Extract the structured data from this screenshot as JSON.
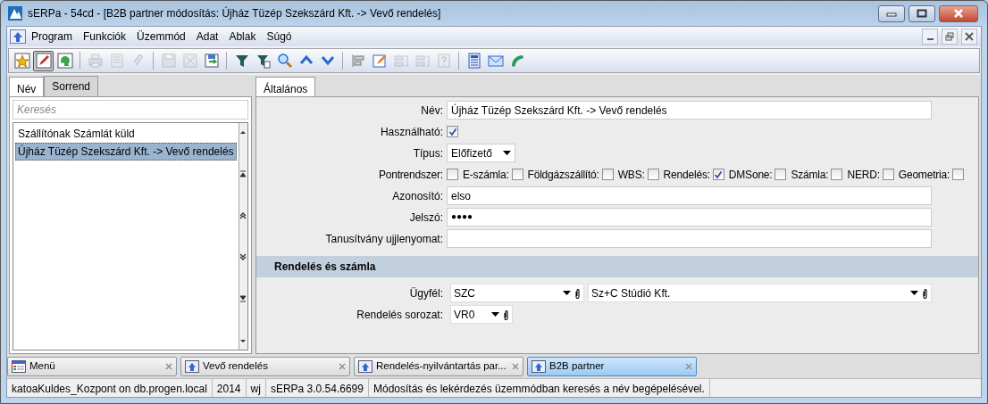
{
  "window": {
    "title": "sERPa - 54cd - [B2B partner módosítás: Újház Tüzép Szekszárd Kft. -> Vevő rendelés]"
  },
  "menu": [
    "Program",
    "Funkciók",
    "Üzemmód",
    "Adat",
    "Ablak",
    "Súgó"
  ],
  "toolbar": [
    [
      {
        "disabled": false,
        "selected": false
      },
      {
        "disabled": false,
        "selected": true
      },
      {
        "disabled": false,
        "selected": false
      }
    ],
    [
      {
        "disabled": true,
        "selected": false
      },
      {
        "disabled": true,
        "selected": false
      },
      {
        "disabled": true,
        "selected": false
      }
    ],
    [
      {
        "disabled": true,
        "selected": false
      },
      {
        "disabled": true,
        "selected": false
      },
      {
        "disabled": false,
        "selected": false
      }
    ],
    [
      {
        "disabled": false,
        "selected": false
      },
      {
        "disabled": false,
        "selected": false
      },
      {
        "disabled": false,
        "selected": false
      },
      {
        "disabled": false,
        "selected": false
      },
      {
        "disabled": false,
        "selected": false
      }
    ],
    [
      {
        "disabled": false,
        "selected": false
      },
      {
        "disabled": false,
        "selected": false
      },
      {
        "disabled": true,
        "selected": false
      },
      {
        "disabled": true,
        "selected": false
      },
      {
        "disabled": true,
        "selected": false
      }
    ],
    [
      {
        "disabled": false,
        "selected": false
      },
      {
        "disabled": false,
        "selected": false
      },
      {
        "disabled": false,
        "selected": false
      }
    ]
  ],
  "left_panel": {
    "tabs": [
      {
        "label": "Név",
        "selected": true
      },
      {
        "label": "Sorrend",
        "selected": false
      }
    ],
    "search": {
      "placeholder": "Keresés"
    },
    "items": [
      {
        "label": "Szállítónak Számlát küld",
        "selected": false
      },
      {
        "label": "Újház Tüzép Szekszárd Kft. -> Vevő rendelés",
        "selected": true
      }
    ]
  },
  "detail": {
    "tabs": [
      {
        "label": "Általános",
        "selected": true
      }
    ],
    "fields": [
      {
        "kind": "text",
        "label": "Név:",
        "value": "Újház Tüzép Szekszárd Kft. -> Vevő rendelés"
      },
      {
        "kind": "checkbox",
        "label": "Használható:",
        "checked": true
      },
      {
        "kind": "select",
        "label": "Típus:",
        "value": "Előfizető"
      },
      {
        "kind": "checkgroup",
        "items": [
          {
            "label": "Pontrendszer:",
            "checked": false
          },
          {
            "label": "E-számla:",
            "checked": false
          },
          {
            "label": "Földgázszállító:",
            "checked": false
          },
          {
            "label": "WBS:",
            "checked": false
          },
          {
            "label": "Rendelés:",
            "checked": true
          },
          {
            "label": "DMSone:",
            "checked": false
          },
          {
            "label": "Számla:",
            "checked": false
          },
          {
            "label": "NERD:",
            "checked": false
          },
          {
            "label": "Geometria:",
            "checked": false
          }
        ]
      },
      {
        "kind": "text",
        "label": "Azonosító:",
        "value": "elso"
      },
      {
        "kind": "password",
        "label": "Jelszó:",
        "value": "●●●●"
      },
      {
        "kind": "text",
        "label": "Tanusítvány ujjlenyomat:"
      }
    ],
    "section": {
      "title": "Rendelés és számla",
      "fields": [
        {
          "label": "Ügyfél:",
          "combos": [
            {
              "value": "SZC"
            },
            {
              "value": "Sz+C Stúdió Kft."
            }
          ]
        },
        {
          "label": "Rendelés sorozat:",
          "combos": [
            {
              "value": "VR0"
            }
          ]
        }
      ]
    }
  },
  "window_tabs": [
    {
      "label": "Menü",
      "selected": false
    },
    {
      "label": "Vevő rendelés",
      "selected": false
    },
    {
      "label": "Rendelés-nyilvántartás par...",
      "selected": false
    },
    {
      "label": "B2B partner",
      "selected": true
    }
  ],
  "status_bar": [
    "katoaKuldes_Kozpont on db.progen.local",
    "2014",
    "wj",
    "sERPa 3.0.54.6699",
    "Módosítás és lekérdezés üzemmódban keresés a név begépelésével."
  ]
}
